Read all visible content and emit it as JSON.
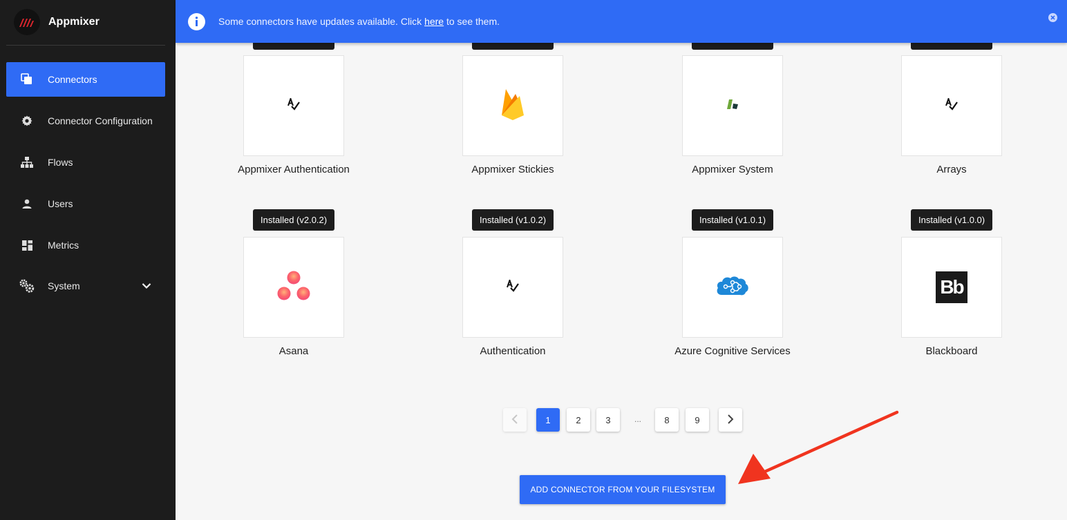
{
  "app": {
    "name": "Appmixer"
  },
  "sidebar": {
    "items": [
      {
        "label": "Connectors",
        "icon": "connectors-icon",
        "active": true
      },
      {
        "label": "Connector Configuration",
        "icon": "gear-icon"
      },
      {
        "label": "Flows",
        "icon": "sitemap-icon"
      },
      {
        "label": "Users",
        "icon": "user-icon"
      },
      {
        "label": "Metrics",
        "icon": "dashboard-icon"
      },
      {
        "label": "System",
        "icon": "cogs-icon",
        "expandable": true
      }
    ]
  },
  "notice": {
    "text_before": "Some connectors have updates available. Click ",
    "link": "here",
    "text_after": " to see them."
  },
  "connectors": [
    {
      "name": "Appmixer Authentication",
      "icon": "authentication-icon"
    },
    {
      "name": "Appmixer Stickies",
      "icon": "firebase-icon"
    },
    {
      "name": "Appmixer System",
      "icon": "appmixer-system-icon"
    },
    {
      "name": "Arrays",
      "icon": "authentication-icon"
    },
    {
      "name": "Asana",
      "badge": "Installed (v2.0.2)",
      "icon": "asana-icon"
    },
    {
      "name": "Authentication",
      "badge": "Installed (v1.0.2)",
      "icon": "authentication-icon"
    },
    {
      "name": "Azure Cognitive Services",
      "badge": "Installed (v1.0.1)",
      "icon": "azure-brain-icon"
    },
    {
      "name": "Blackboard",
      "badge": "Installed (v1.0.0)",
      "icon": "blackboard-icon",
      "icon_text": "Bb"
    }
  ],
  "pagination": {
    "pages": [
      "1",
      "2",
      "3",
      "8",
      "9"
    ],
    "ellipsis": "...",
    "current": "1"
  },
  "actions": {
    "add_connector": "ADD CONNECTOR FROM YOUR FILESYSTEM"
  },
  "colors": {
    "accent": "#2f6bf5",
    "sidebar": "#1c1c1c",
    "badge": "#1d1d1d"
  }
}
